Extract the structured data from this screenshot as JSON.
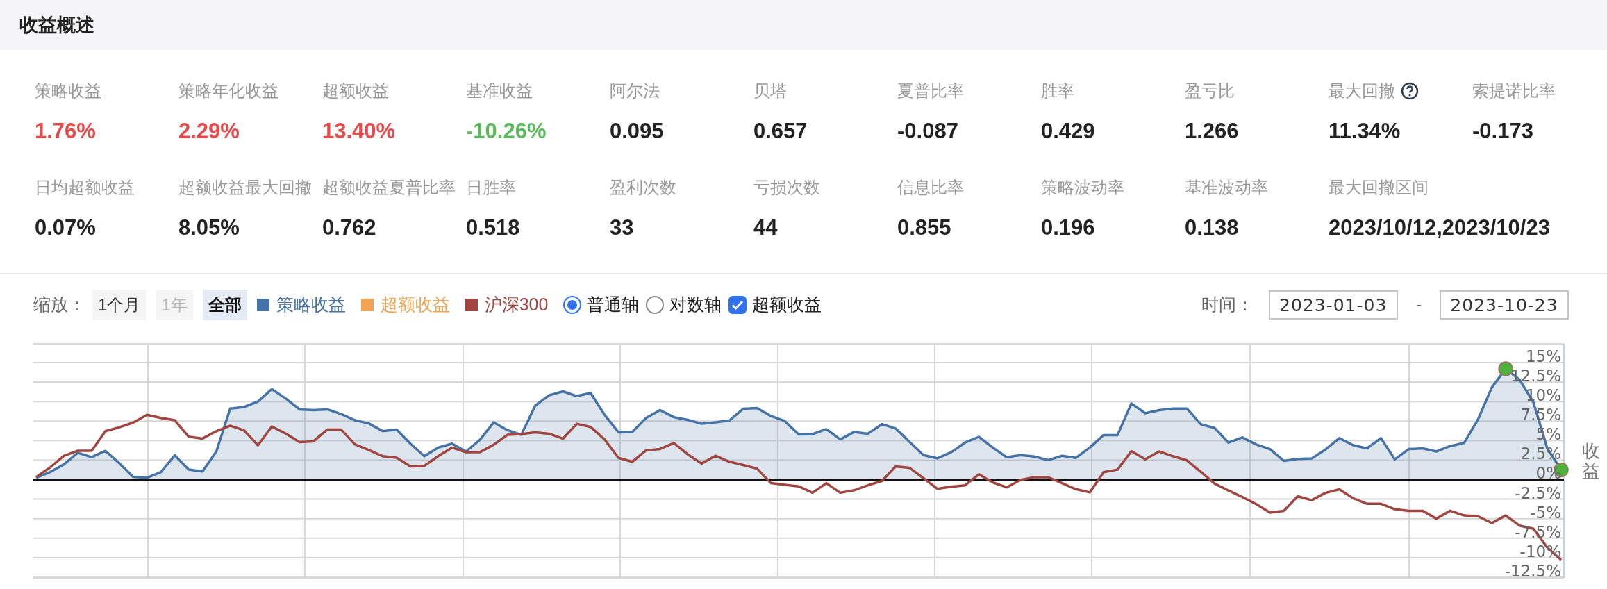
{
  "section": {
    "title": "收益概述"
  },
  "stats": [
    {
      "label": "策略收益",
      "value": "1.76%",
      "color": "#e84a4a"
    },
    {
      "label": "策略年化收益",
      "value": "2.29%",
      "color": "#e84a4a"
    },
    {
      "label": "超额收益",
      "value": "13.40%",
      "color": "#e84a4a"
    },
    {
      "label": "基准收益",
      "value": "-10.26%",
      "color": "#5cb85c"
    },
    {
      "label": "阿尔法",
      "value": "0.095",
      "color": "#222222"
    },
    {
      "label": "贝塔",
      "value": "0.657",
      "color": "#222222"
    },
    {
      "label": "夏普比率",
      "value": "-0.087",
      "color": "#222222"
    },
    {
      "label": "胜率",
      "value": "0.429",
      "color": "#222222"
    },
    {
      "label": "盈亏比",
      "value": "1.266",
      "color": "#222222"
    },
    {
      "label": "最大回撤",
      "value": "11.34%",
      "color": "#222222",
      "help": true
    },
    {
      "label": "索提诺比率",
      "value": "-0.173",
      "color": "#222222"
    },
    {
      "label": "日均超额收益",
      "value": "0.07%",
      "color": "#222222"
    },
    {
      "label": "超额收益最大回撤",
      "value": "8.05%",
      "color": "#222222"
    },
    {
      "label": "超额收益夏普比率",
      "value": "0.762",
      "color": "#222222"
    },
    {
      "label": "日胜率",
      "value": "0.518",
      "color": "#222222"
    },
    {
      "label": "盈利次数",
      "value": "33",
      "color": "#222222"
    },
    {
      "label": "亏损次数",
      "value": "44",
      "color": "#222222"
    },
    {
      "label": "信息比率",
      "value": "0.855",
      "color": "#222222"
    },
    {
      "label": "策略波动率",
      "value": "0.196",
      "color": "#222222"
    },
    {
      "label": "基准波动率",
      "value": "0.138",
      "color": "#222222"
    },
    {
      "label": "最大回撤区间",
      "value": "2023/10/12,2023/10/23",
      "color": "#222222"
    }
  ],
  "toolbar": {
    "zoom_label": "缩放：",
    "zoom_buttons": [
      {
        "label": "1个月",
        "selected": false,
        "disabled": false
      },
      {
        "label": "1年",
        "selected": false,
        "disabled": true
      },
      {
        "label": "全部",
        "selected": true,
        "disabled": false
      }
    ],
    "legend": [
      {
        "label": "策略收益",
        "color": "#4572a7"
      },
      {
        "label": "超额收益",
        "color": "#f4a352"
      },
      {
        "label": "沪深300",
        "color": "#a0453f"
      }
    ],
    "axis_options": [
      {
        "label": "普通轴",
        "selected": true
      },
      {
        "label": "对数轴",
        "selected": false
      }
    ],
    "excess_toggle": {
      "label": "超额收益",
      "checked": true
    },
    "time_label": "时间：",
    "start_date": "2023-01-03",
    "separator": "-",
    "end_date": "2023-10-23"
  },
  "chart": {
    "chart_data": {
      "type": "line",
      "grid": true,
      "ylabel": "收益",
      "ylim": [
        -12.6,
        17.4
      ],
      "yticks": [
        {
          "value": 15,
          "label": "15%"
        },
        {
          "value": 12.5,
          "label": "12.5%"
        },
        {
          "value": 10,
          "label": "10%"
        },
        {
          "value": 7.5,
          "label": "7.5%"
        },
        {
          "value": 5,
          "label": "5%"
        },
        {
          "value": 2.5,
          "label": "2.5%"
        },
        {
          "value": 0,
          "label": "0%"
        },
        {
          "value": -2.5,
          "label": "-2.5%"
        },
        {
          "value": -5,
          "label": "-5%"
        },
        {
          "value": -7.5,
          "label": "-7.5%"
        },
        {
          "value": -10,
          "label": "-10%"
        },
        {
          "value": -12.5,
          "label": "-12.5%"
        }
      ],
      "series": [
        {
          "color": "#4572a7",
          "values": [
            0.24,
            0.96,
            1.95,
            3.43,
            2.87,
            3.67,
            2.1,
            0.36,
            0.24,
            0.96,
            3.1,
            1.3,
            1.04,
            3.6,
            9.1,
            9.3,
            10.0,
            11.6,
            10.4,
            9.0,
            8.9,
            9.0,
            8.4,
            7.6,
            7.2,
            6.2,
            6.4,
            4.6,
            3.0,
            4.1,
            4.6,
            3.6,
            5.06,
            7.33,
            6.33,
            5.74,
            9.48,
            10.8,
            11.3,
            10.7,
            11.1,
            8.3,
            6.06,
            6.1,
            7.9,
            8.9,
            8.0,
            7.65,
            7.15,
            7.33,
            7.56,
            9.07,
            9.16,
            8.15,
            7.5,
            5.79,
            5.83,
            6.47,
            5.15,
            6.1,
            5.88,
            7.1,
            6.56,
            4.83,
            3.14,
            2.73,
            3.5,
            4.74,
            5.47,
            4.1,
            2.87,
            3.14,
            2.96,
            2.5,
            3.05,
            2.78,
            4.1,
            5.7,
            5.7,
            9.75,
            8.5,
            8.9,
            9.1,
            9.1,
            7.1,
            6.6,
            4.74,
            5.4,
            4.5,
            3.9,
            2.4,
            2.64,
            2.7,
            3.85,
            5.3,
            4.4,
            4.0,
            5.3,
            2.6,
            3.9,
            4.0,
            3.6,
            4.3,
            4.7,
            7.7,
            11.8,
            14.2,
            12.8,
            9.9,
            4.0,
            1.25
          ]
        },
        {
          "color": "#a0453f",
          "values": [
            0.32,
            1.55,
            3.03,
            3.7,
            3.7,
            6.2,
            6.7,
            7.3,
            8.3,
            7.9,
            7.6,
            5.5,
            5.26,
            6.2,
            6.9,
            6.3,
            4.4,
            6.8,
            5.9,
            4.8,
            4.9,
            6.4,
            6.4,
            4.5,
            3.8,
            3.0,
            2.8,
            1.7,
            1.75,
            3.0,
            4.1,
            3.5,
            3.5,
            4.46,
            5.74,
            5.83,
            6.06,
            5.88,
            5.24,
            7.15,
            6.74,
            5.15,
            2.78,
            2.28,
            3.74,
            3.92,
            4.69,
            3.23,
            2.05,
            3.05,
            2.28,
            1.87,
            1.41,
            -0.46,
            -0.68,
            -0.87,
            -1.69,
            -0.46,
            -1.69,
            -1.37,
            -0.73,
            -0.18,
            1.69,
            1.5,
            0.18,
            -1.18,
            -0.91,
            -0.73,
            0.68,
            -0.36,
            -1.0,
            -0.05,
            0.32,
            0.3,
            -0.46,
            -1.23,
            -1.64,
            0.96,
            1.28,
            3.64,
            2.6,
            3.6,
            3.0,
            2.46,
            1.0,
            -0.5,
            -1.4,
            -2.23,
            -3.14,
            -4.24,
            -4.0,
            -2.14,
            -2.64,
            -1.7,
            -1.25,
            -2.4,
            -3.1,
            -3.1,
            -3.8,
            -4.0,
            -4.0,
            -5.0,
            -4.0,
            -4.6,
            -4.7,
            -5.57,
            -4.6,
            -5.9,
            -6.3,
            -8.7,
            -10.3
          ]
        }
      ]
    }
  }
}
